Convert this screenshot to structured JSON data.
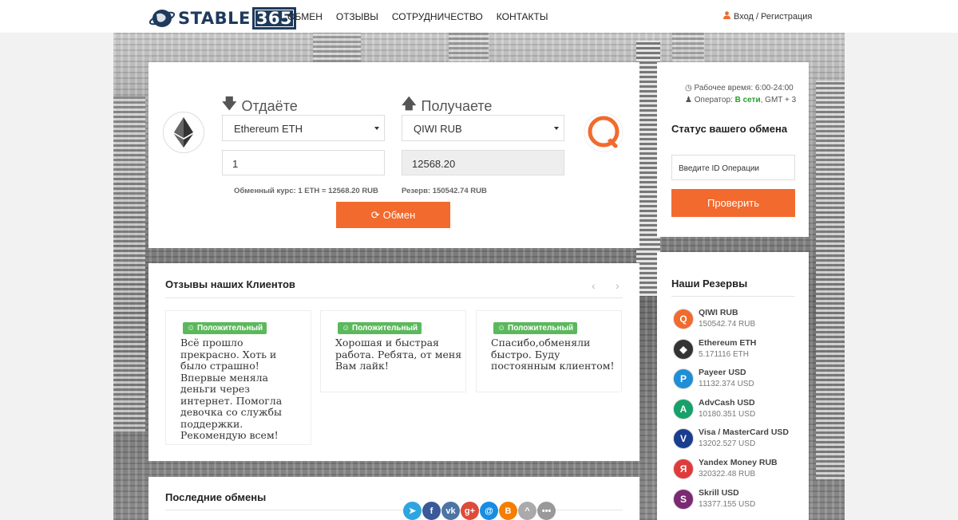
{
  "header": {
    "logo_text": "STABLE",
    "logo_number": "365",
    "nav": [
      "ОБМЕН",
      "ОТЗЫВЫ",
      "СОТРУДНИЧЕСТВО",
      "КОНТАКТЫ"
    ],
    "login": "Вход / Регистрация"
  },
  "exchange": {
    "give_title": "Отдаёте",
    "get_title": "Получаете",
    "give_currency": "Ethereum ETH",
    "get_currency": "QIWI RUB",
    "give_amount": "1",
    "get_amount": "12568.20",
    "rate_note": "Обменный курс: 1 ETH = 12568.20 RUB",
    "reserve_note": "Резерв: 150542.74 RUB",
    "exchange_button": "Обмен"
  },
  "reviews": {
    "title": "Отзывы наших Клиентов",
    "items": [
      {
        "badge": "Положительный",
        "text": "Всё прошло прекрасно. Хоть и было страшно! Впервые меняла деньги через интернет. Помогла девочка со службы поддержки. Рекомендую всем!"
      },
      {
        "badge": "Положительный",
        "text": "Хорошая и быстрая работа. Ребята, от меня Вам лайк!"
      },
      {
        "badge": "Положительный",
        "text": "Спасибо,обменяли быстро. Буду постоянным клиентом!"
      }
    ]
  },
  "recent": {
    "title": "Последние обмены"
  },
  "status": {
    "work_hours": "Рабочее время: 6:00-24:00",
    "operator_label": "Оператор:",
    "operator_status": "В сети",
    "timezone": ", GMT + 3",
    "title": "Статус вашего обмена",
    "id_placeholder": "Введите ID Операции",
    "check_button": "Проверить"
  },
  "reserves": {
    "title": "Наши Резервы",
    "items": [
      {
        "name": "QIWI RUB",
        "amount": "150542.74 RUB",
        "icon": "qiwi-icon",
        "color": "#f26a2e"
      },
      {
        "name": "Ethereum ETH",
        "amount": "5.171116 ETH",
        "icon": "ethereum-icon",
        "color": "#333333"
      },
      {
        "name": "Payeer USD",
        "amount": "11132.374 USD",
        "icon": "payeer-icon",
        "color": "#1f8ed6"
      },
      {
        "name": "AdvCash USD",
        "amount": "10180.351 USD",
        "icon": "advcash-icon",
        "color": "#16a06a"
      },
      {
        "name": "Visa / MasterCard USD",
        "amount": "13202.527 USD",
        "icon": "visa-icon",
        "color": "#1a3d8f"
      },
      {
        "name": "Yandex Money RUB",
        "amount": "320322.48 RUB",
        "icon": "yandex-icon",
        "color": "#e03b3b"
      },
      {
        "name": "Skrill USD",
        "amount": "13377.155 USD",
        "icon": "skrill-icon",
        "color": "#7a2a72"
      }
    ]
  },
  "social": [
    {
      "icon": "telegram-icon",
      "color": "#2ca5e0"
    },
    {
      "icon": "facebook-icon",
      "color": "#3b5998"
    },
    {
      "icon": "vk-icon",
      "color": "#4c75a3"
    },
    {
      "icon": "google-plus-icon",
      "color": "#dd4b39"
    },
    {
      "icon": "mail-icon",
      "color": "#168de2"
    },
    {
      "icon": "blogger-icon",
      "color": "#f57d00"
    },
    {
      "icon": "odnoklassniki-icon",
      "color": "#aaaaaa"
    },
    {
      "icon": "more-icon",
      "color": "#999999"
    }
  ]
}
